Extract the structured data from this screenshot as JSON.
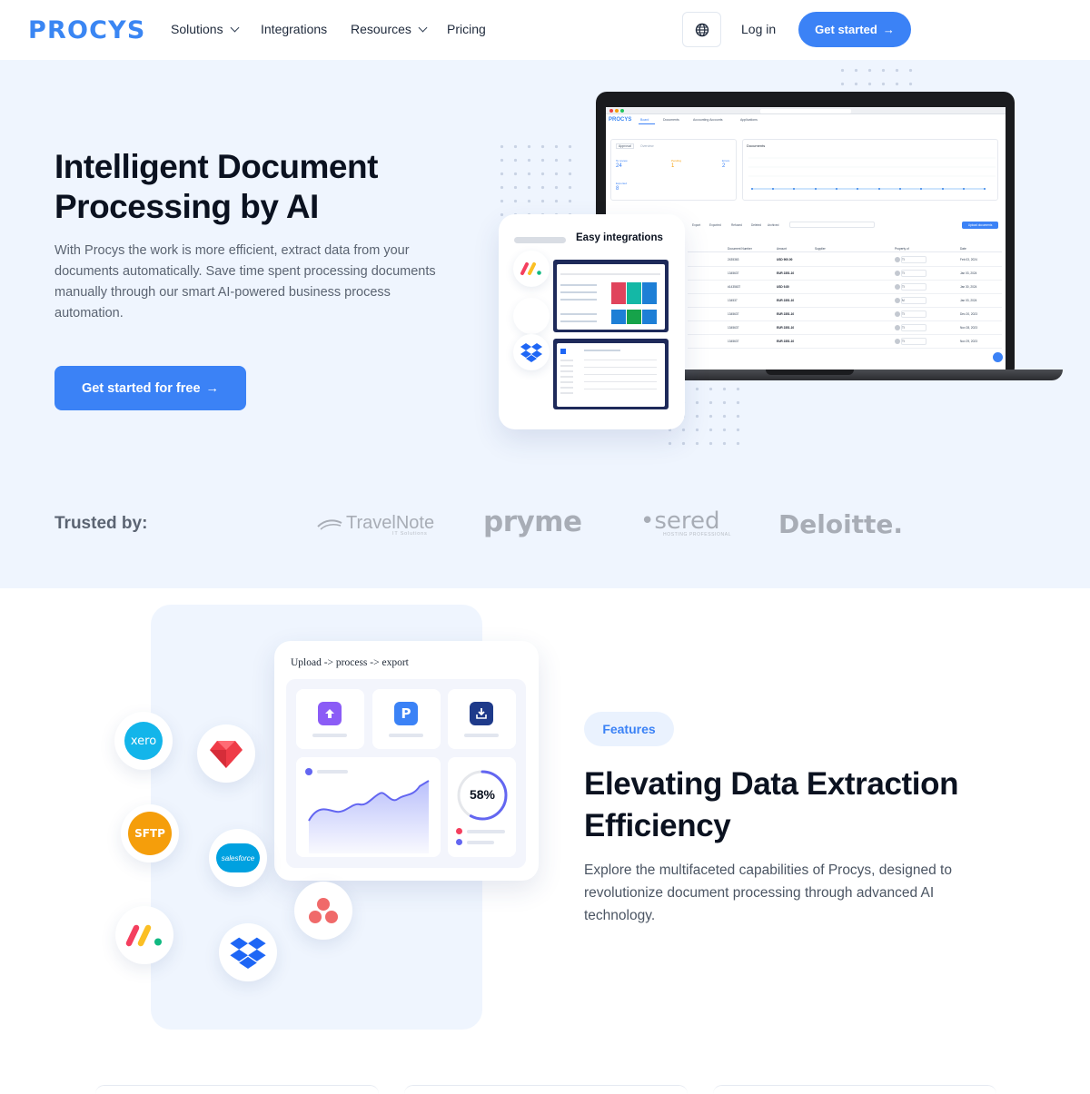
{
  "nav": {
    "logo": "PROCYS",
    "links": [
      {
        "label": "Solutions",
        "dropdown": true
      },
      {
        "label": "Integrations",
        "dropdown": false
      },
      {
        "label": "Resources",
        "dropdown": true
      },
      {
        "label": "Pricing",
        "dropdown": false
      }
    ],
    "login": "Log in",
    "cta": "Get started",
    "language_icon": "globe-icon"
  },
  "hero": {
    "title": "Intelligent Document Processing by AI",
    "lead": "With Procys the work is more efficient, extract data from your documents automatically. Save time spent processing documents manually through our smart AI-powered business process automation.",
    "cta": "Get started for free",
    "trusted_label": "Trusted by:",
    "brands": [
      "TravelNote",
      "pryme",
      "sered",
      "Deloitte."
    ],
    "brand_sublabels": {
      "TravelNote": "IT Solutions",
      "sered": "HOSTING PROFESSIONAL"
    }
  },
  "laptop": {
    "app_logo": "PROCYS",
    "tabs": [
      "Board",
      "Documents",
      "Accounting Accounts",
      "Applications"
    ],
    "stats_tabs": [
      "Approval",
      "Overview"
    ],
    "stats": [
      {
        "label": "To review",
        "value": "24"
      },
      {
        "label": "Pending",
        "value": "1"
      },
      {
        "label": "Errors",
        "value": "2"
      },
      {
        "label": "Exported",
        "value": "8"
      }
    ],
    "chart_title": "Documents",
    "filters": [
      "Export",
      "Exported",
      "Refused",
      "Deleted",
      "Archived"
    ],
    "upload_button": "Upload documents",
    "columns": [
      "Document Number",
      "Amount",
      "Supplier",
      "Property of",
      "Date"
    ],
    "rows": [
      {
        "number": "2435363",
        "amount": "USD 900.00",
        "owner": "TI",
        "date": "Feb 03, 2024"
      },
      {
        "number": "1345637",
        "amount": "EUR 2351.10",
        "owner": "TI",
        "date": "Jan 03, 2024"
      },
      {
        "number": "#1435637",
        "amount": "USD 9.80",
        "owner": "TI",
        "date": "Jan 30, 2024"
      },
      {
        "number": "134537",
        "amount": "EUR 2351.10",
        "owner": "M",
        "date": "Jan 03, 2024"
      },
      {
        "number": "1345637",
        "amount": "EUR 2351.10",
        "owner": "TI",
        "date": "Dec 20, 2023"
      },
      {
        "number": "1345637",
        "amount": "EUR 2351.10",
        "owner": "TI",
        "date": "Nov 28, 2023"
      },
      {
        "number": "1345637",
        "amount": "EUR 2351.10",
        "owner": "TI",
        "date": "Nov 29, 2023"
      }
    ]
  },
  "integrations_card": {
    "title": "Easy integrations",
    "icons": [
      "monday-icon",
      "dropbox-icon"
    ]
  },
  "features": {
    "dashboard_title": "Upload -> process -> export",
    "progress_percent": "58%",
    "progress_value": 0.58,
    "badge": "Features",
    "title": "Elevating Data Extraction Efficiency",
    "description": "Explore the multifaceted capabilities of Procys, designed to revolutionize document processing through advanced AI technology.",
    "integration_icons": [
      {
        "name": "xero-icon",
        "label": "xero"
      },
      {
        "name": "sftp-icon",
        "label": "SFTP"
      },
      {
        "name": "salesforce-icon",
        "label": "salesforce"
      }
    ]
  },
  "colors": {
    "accent": "#3b82f6",
    "hero_bg": "#eff5fe",
    "heading": "#0b1220"
  }
}
